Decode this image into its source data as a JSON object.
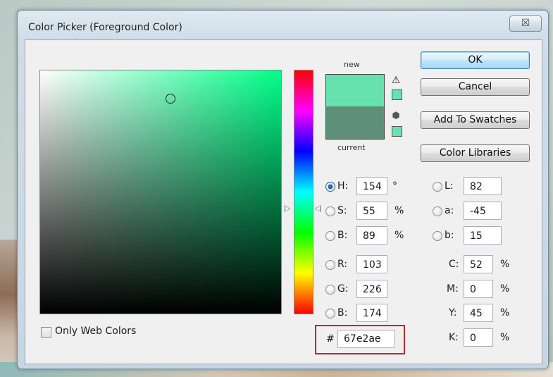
{
  "window": {
    "title": "Color Picker (Foreground Color)",
    "close_glyph": "☒"
  },
  "swatch": {
    "new_label": "new",
    "current_label": "current",
    "new_color": "#67e2ae",
    "current_color": "#5e8f78",
    "warning_icon": "gamut-warning-icon",
    "web_icon": "web-safe-cube-icon"
  },
  "buttons": {
    "ok": "OK",
    "cancel": "Cancel",
    "add_to_swatches": "Add To Swatches",
    "color_libraries": "Color Libraries"
  },
  "hsb": {
    "h": {
      "label": "H:",
      "value": "154",
      "unit": "°",
      "selected": true
    },
    "s": {
      "label": "S:",
      "value": "55",
      "unit": "%"
    },
    "b": {
      "label": "B:",
      "value": "89",
      "unit": "%"
    }
  },
  "rgb": {
    "r": {
      "label": "R:",
      "value": "103"
    },
    "g": {
      "label": "G:",
      "value": "226"
    },
    "b": {
      "label": "B:",
      "value": "174"
    }
  },
  "lab": {
    "l": {
      "label": "L:",
      "value": "82"
    },
    "a": {
      "label": "a:",
      "value": "-45"
    },
    "b": {
      "label": "b:",
      "value": "15"
    }
  },
  "cmyk": {
    "c": {
      "label": "C:",
      "value": "52",
      "unit": "%"
    },
    "m": {
      "label": "M:",
      "value": "0",
      "unit": "%"
    },
    "y": {
      "label": "Y:",
      "value": "45",
      "unit": "%"
    },
    "k": {
      "label": "K:",
      "value": "0",
      "unit": "%"
    }
  },
  "hex": {
    "prefix": "#",
    "value": "67e2ae"
  },
  "web_colors": {
    "label": "Only Web Colors",
    "checked": false
  },
  "colors": {
    "highlight_outline": "#c0272d",
    "field_hue": "#00ff88"
  }
}
